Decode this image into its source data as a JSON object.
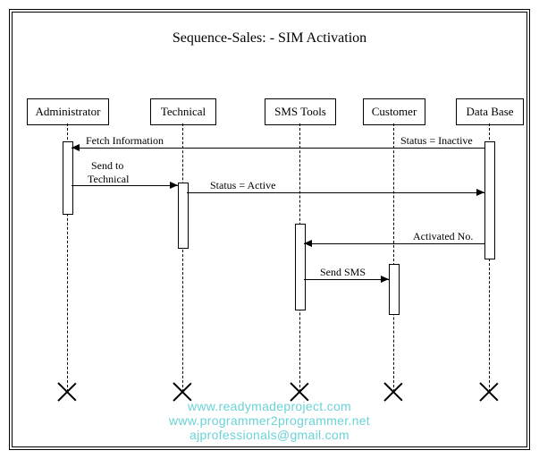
{
  "title": "Sequence-Sales: - SIM Activation",
  "actors": {
    "admin": "Administrator",
    "tech": "Technical",
    "sms": "SMS Tools",
    "cust": "Customer",
    "db": "Data Base"
  },
  "messages": {
    "fetch": "Fetch Information",
    "status_inactive": "Status = Inactive",
    "send_tech1": "Send to",
    "send_tech2": "Technical",
    "status_active": "Status = Active",
    "activated": "Activated No.",
    "send_sms": "Send SMS"
  },
  "watermark": {
    "line1": "www.readymadeproject.com",
    "line2": "www.programmer2programmer.net",
    "line3": "ajprofessionals@gmail.com"
  }
}
